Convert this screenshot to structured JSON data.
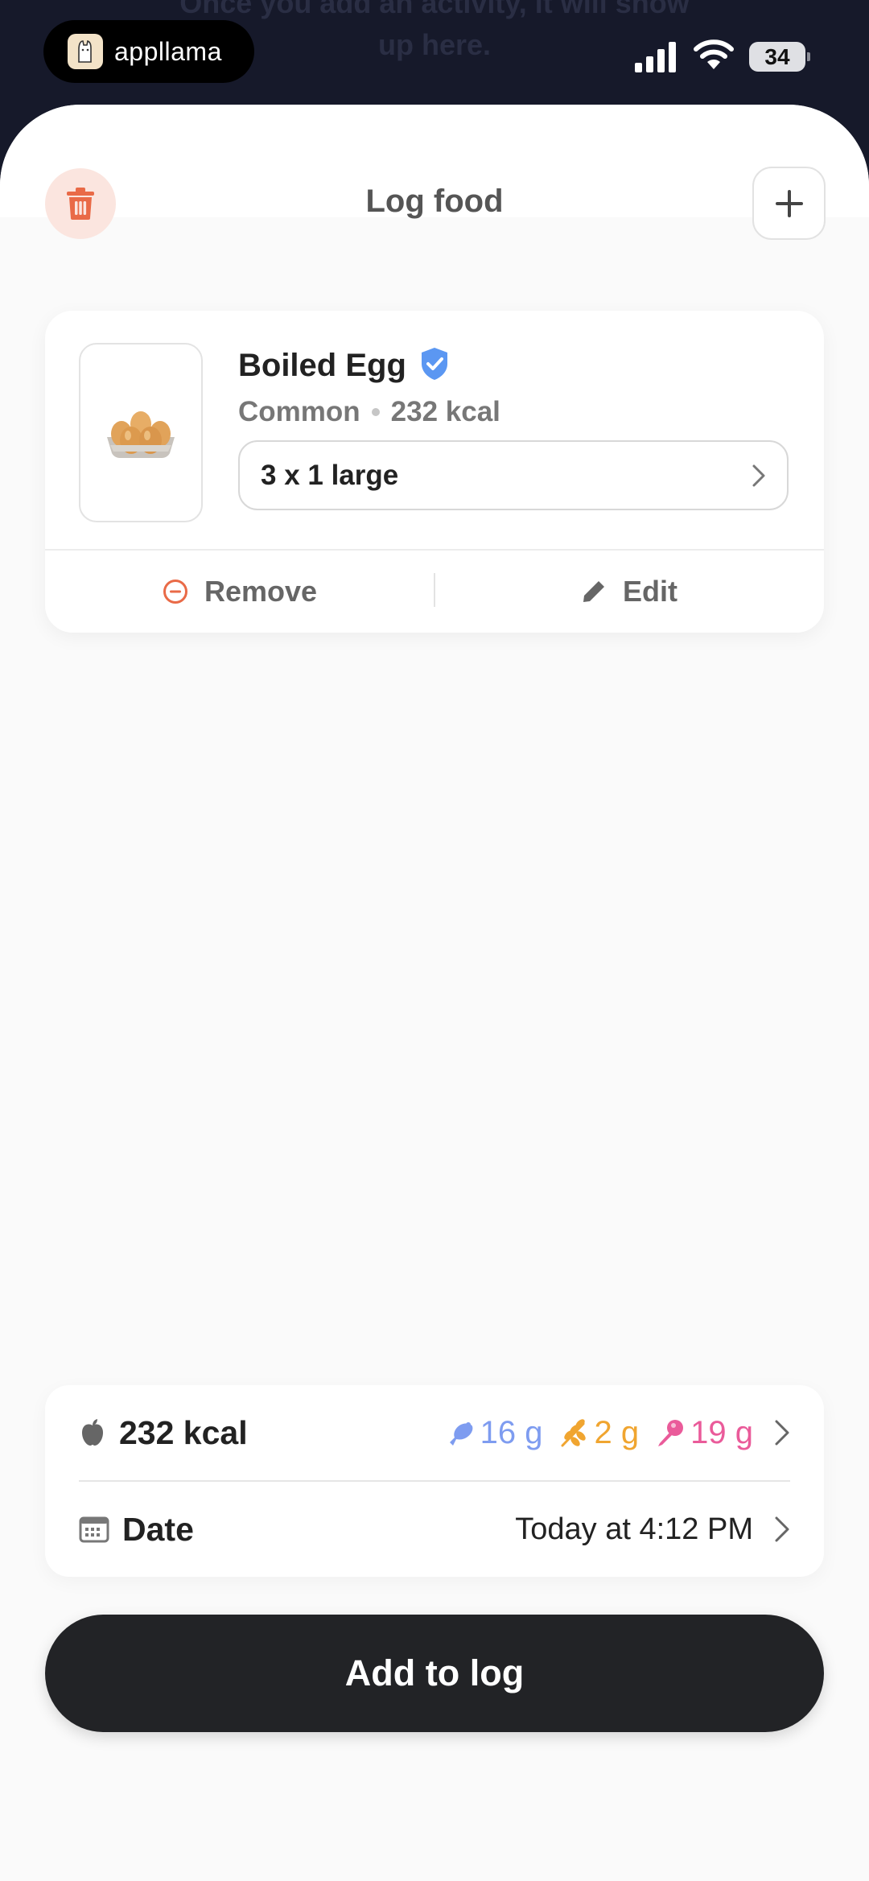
{
  "background": {
    "text_line1": "Once you add an activity, it will show",
    "text_line2": "up here."
  },
  "status_bar": {
    "brand": "appllama",
    "battery": "34"
  },
  "header": {
    "title": "Log food"
  },
  "food_item": {
    "name": "Boiled Egg",
    "category": "Common",
    "calories": "232 kcal",
    "serving": "3 x 1 large",
    "remove_label": "Remove",
    "edit_label": "Edit"
  },
  "summary": {
    "calories": "232 kcal",
    "protein": "16 g",
    "carbs": "2 g",
    "fat": "19 g",
    "date_label": "Date",
    "date_value": "Today at 4:12 PM"
  },
  "colors": {
    "danger": "#e96a47",
    "protein": "#7e9cf0",
    "carbs": "#f0a530",
    "fat": "#ea5b9a",
    "verified": "#5b97f2",
    "primary_button": "#222326"
  },
  "primary_action": {
    "label": "Add to log"
  }
}
